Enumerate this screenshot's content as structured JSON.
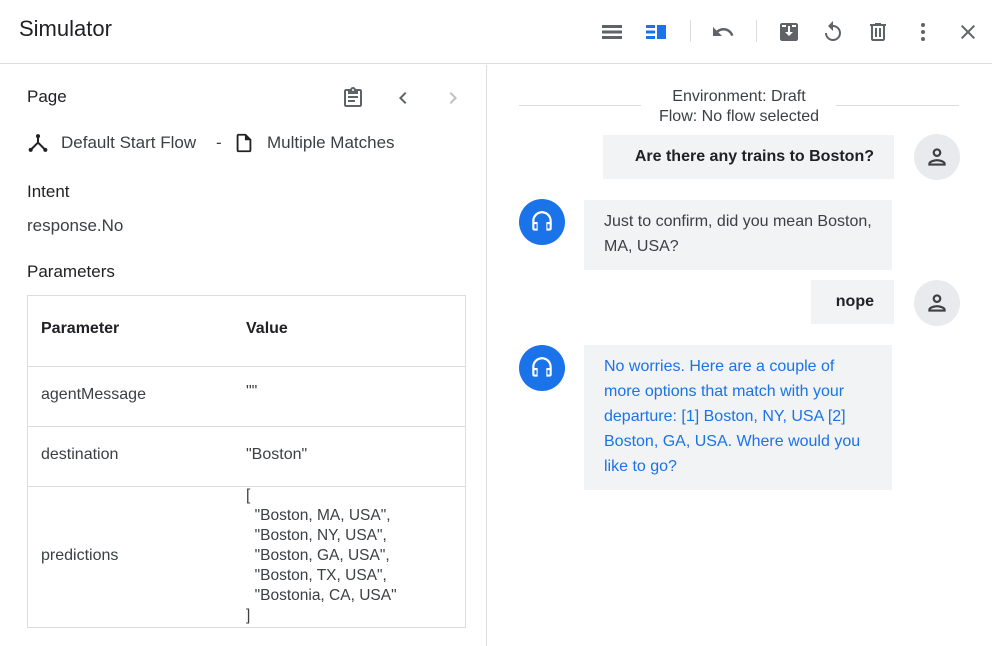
{
  "header": {
    "title": "Simulator",
    "toolbar_icons": [
      "list-view-icon",
      "split-view-icon",
      "undo-icon",
      "download-icon",
      "reset-icon",
      "delete-icon",
      "more-vert-icon",
      "close-icon"
    ]
  },
  "page_section": {
    "label": "Page",
    "flow": "Default Start Flow",
    "separator": "-",
    "page": "Multiple Matches"
  },
  "intent_section": {
    "label": "Intent",
    "value": "response.No"
  },
  "parameters_section": {
    "label": "Parameters",
    "columns": [
      "Parameter",
      "Value"
    ],
    "rows": [
      {
        "name": "agentMessage",
        "value": "\"\""
      },
      {
        "name": "destination",
        "value": "\"Boston\""
      },
      {
        "name": "predictions",
        "value": "[\n  \"Boston, MA, USA\",\n  \"Boston, NY, USA\",\n  \"Boston, GA, USA\",\n  \"Boston, TX, USA\",\n  \"Bostonia, CA, USA\"\n]"
      }
    ]
  },
  "conversation": {
    "environment": "Environment: Draft",
    "flow": "Flow: No flow selected",
    "messages": [
      {
        "role": "user",
        "text": "Are there any trains to Boston?"
      },
      {
        "role": "agent",
        "text": "Just to confirm, did you mean Boston, MA, USA?"
      },
      {
        "role": "user",
        "text": "nope"
      },
      {
        "role": "agent",
        "text": "No worries. Here are a couple of more options that match with your departure: [1] Boston, NY, USA [2] Boston, GA, USA. Where would you like to go?"
      }
    ]
  },
  "colors": {
    "accent": "#1a73e8",
    "icon_gray": "#5f6368",
    "bubble_bg": "#f1f3f4",
    "divider": "#dadce0"
  }
}
